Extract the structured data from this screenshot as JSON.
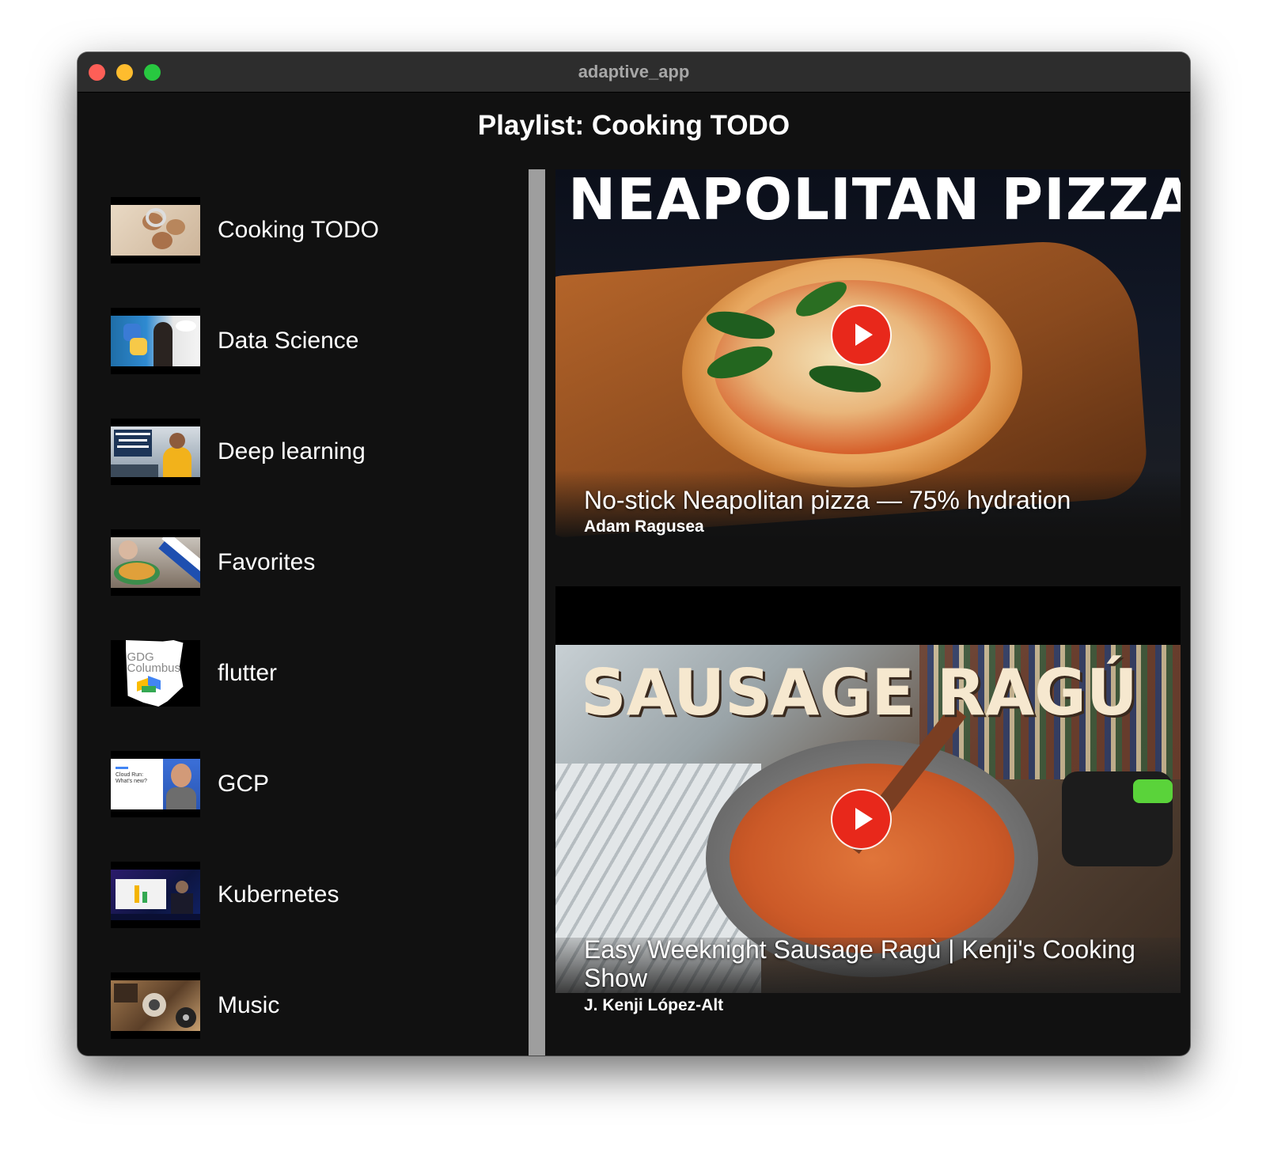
{
  "window": {
    "title": "adaptive_app"
  },
  "header": {
    "title": "Playlist: Cooking TODO"
  },
  "playlists": [
    {
      "label": "Cooking TODO",
      "thumb_icon": "scones-thumbnail"
    },
    {
      "label": "Data Science",
      "thumb_icon": "data-science-thumbnail"
    },
    {
      "label": "Deep learning",
      "thumb_icon": "tensorflow-thumbnail"
    },
    {
      "label": "Favorites",
      "thumb_icon": "bread-pudding-thumbnail"
    },
    {
      "label": "flutter",
      "thumb_icon": "gdg-columbus-thumbnail",
      "thumb_text": [
        "GDG",
        "Columbus"
      ]
    },
    {
      "label": "GCP",
      "thumb_icon": "cloud-run-thumbnail",
      "thumb_text": [
        "Cloud Run:",
        "What's new?"
      ]
    },
    {
      "label": "Kubernetes",
      "thumb_icon": "kubernetes-thumbnail"
    },
    {
      "label": "Music",
      "thumb_icon": "music-thumbnail"
    }
  ],
  "videos": [
    {
      "thumbnail_text": "NEAPOLITAN PIZZA",
      "title": "No-stick Neapolitan pizza — 75% hydration",
      "author": "Adam Ragusea"
    },
    {
      "thumbnail_text": "SAUSAGE RAGÚ",
      "title": "Easy Weeknight Sausage Ragù | Kenji's Cooking Show",
      "author": "J. Kenji López-Alt"
    }
  ],
  "colors": {
    "background": "#111111",
    "divider": "#9e9e9e",
    "play_button": "#e8281b"
  }
}
